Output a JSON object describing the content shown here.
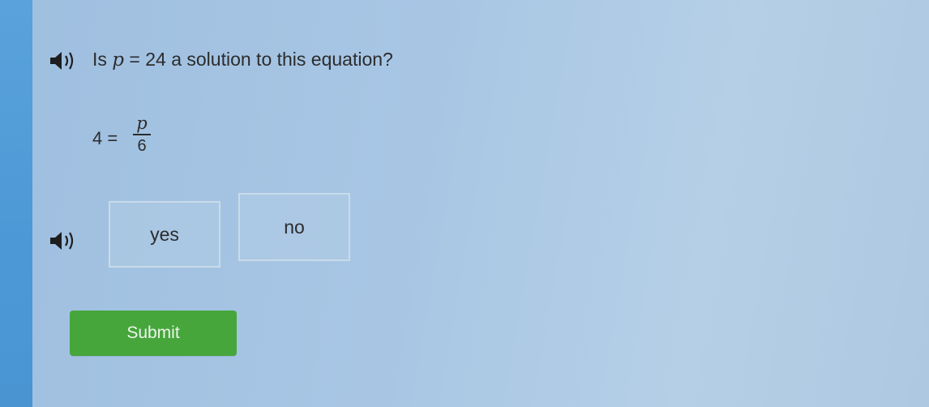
{
  "question": {
    "prefix": "Is ",
    "variable": "p",
    "equals_value": " = 24",
    "suffix": " a solution to this equation?"
  },
  "equation": {
    "lhs": "4 =",
    "numerator": "p",
    "denominator": "6"
  },
  "choices": [
    {
      "label": "yes"
    },
    {
      "label": "no"
    }
  ],
  "submit_label": "Submit",
  "icons": {
    "question_audio": "speaker-icon",
    "choices_audio": "speaker-icon"
  },
  "colors": {
    "accent_strip": "#4c98d6",
    "submit_green": "#46a63c",
    "background": "#a8c6e4"
  }
}
